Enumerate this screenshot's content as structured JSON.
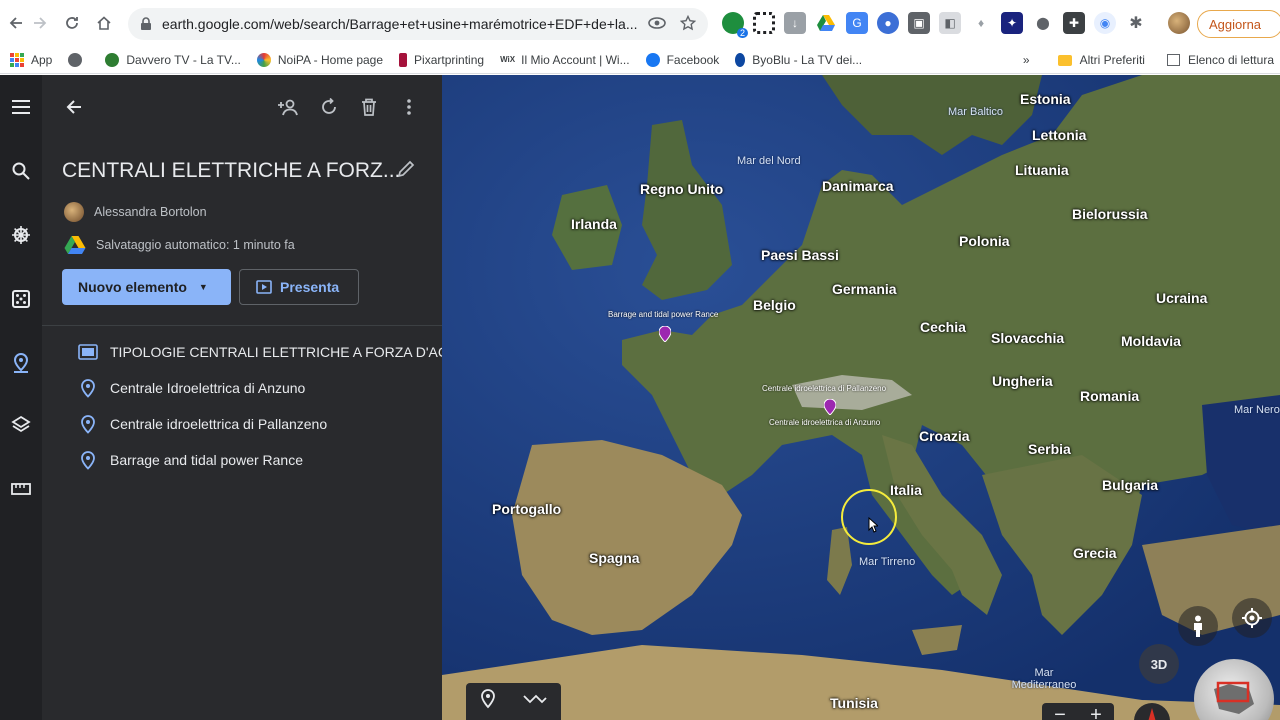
{
  "browser": {
    "url": "earth.google.com/web/search/Barrage+et+usine+marémotrice+EDF+de+la...",
    "update_label": "Aggiorna",
    "bookmarks": [
      {
        "label": "App",
        "icon": "apps-grid-icon"
      },
      {
        "label": "",
        "icon": "globe-icon"
      },
      {
        "label": "Davvero TV - La TV...",
        "icon": "davvero-icon"
      },
      {
        "label": "NoiPA - Home page",
        "icon": "noipa-icon"
      },
      {
        "label": "Pixartprinting",
        "icon": "pixart-icon"
      },
      {
        "label": "Il Mio Account | Wi...",
        "icon": "wix-icon"
      },
      {
        "label": "Facebook",
        "icon": "facebook-icon"
      },
      {
        "label": "ByoBlu - La TV dei...",
        "icon": "byoblu-icon"
      }
    ],
    "bookmarks_more": "»",
    "other_bookmarks": "Altri Preferiti",
    "reading_list": "Elenco di lettura",
    "extension_badge": "2"
  },
  "panel": {
    "title": "CENTRALI ELETTRICHE A FORZ...",
    "owner": "Alessandra Bortolon",
    "autosave": "Salvataggio automatico: 1 minuto fa",
    "new_item": "Nuovo elemento",
    "present": "Presenta",
    "features": [
      {
        "label": "TIPOLOGIE CENTRALI ELETTRICHE A FORZA D'AC...",
        "icon": "slide-icon"
      },
      {
        "label": "Centrale Idroelettrica di Anzuno",
        "icon": "placemark-icon"
      },
      {
        "label": "Centrale idroelettrica di Pallanzeno",
        "icon": "placemark-icon"
      },
      {
        "label": "Barrage and tidal power Rance",
        "icon": "placemark-icon"
      }
    ]
  },
  "map": {
    "countries": [
      {
        "label": "Estonia"
      },
      {
        "label": "Lettonia"
      },
      {
        "label": "Lituania"
      },
      {
        "label": "Regno Unito"
      },
      {
        "label": "Danimarca"
      },
      {
        "label": "Irlanda"
      },
      {
        "label": "Bielorussia"
      },
      {
        "label": "Polonia"
      },
      {
        "label": "Paesi Bassi"
      },
      {
        "label": "Germania"
      },
      {
        "label": "Belgio"
      },
      {
        "label": "Ucraina"
      },
      {
        "label": "Cechia"
      },
      {
        "label": "Slovacchia"
      },
      {
        "label": "Moldavia"
      },
      {
        "label": "Ungheria"
      },
      {
        "label": "Romania"
      },
      {
        "label": "Croazia"
      },
      {
        "label": "Serbia"
      },
      {
        "label": "Italia"
      },
      {
        "label": "Bulgaria"
      },
      {
        "label": "Portogallo"
      },
      {
        "label": "Spagna"
      },
      {
        "label": "Grecia"
      },
      {
        "label": "Tunisia"
      }
    ],
    "seas": [
      {
        "label": "Mar Baltico"
      },
      {
        "label": "Mar del Nord"
      },
      {
        "label": "Mar Nero"
      },
      {
        "label": "Mar Tirreno"
      },
      {
        "label": "Mar Mediterraneo"
      }
    ],
    "placemarks": [
      {
        "label": "Barrage and tidal power Rance"
      },
      {
        "label": "Centrale idroelettrica di Pallanzeno"
      },
      {
        "label": "Centrale idroelettrica di Anzuno"
      }
    ],
    "btn_3d": "3D",
    "zoom_out": "−",
    "zoom_in": "+"
  },
  "colors": {
    "accent": "#8ab4f8",
    "panel_bg": "#292a2d",
    "rail_bg": "#202124",
    "placemark": "#9c27b0"
  }
}
